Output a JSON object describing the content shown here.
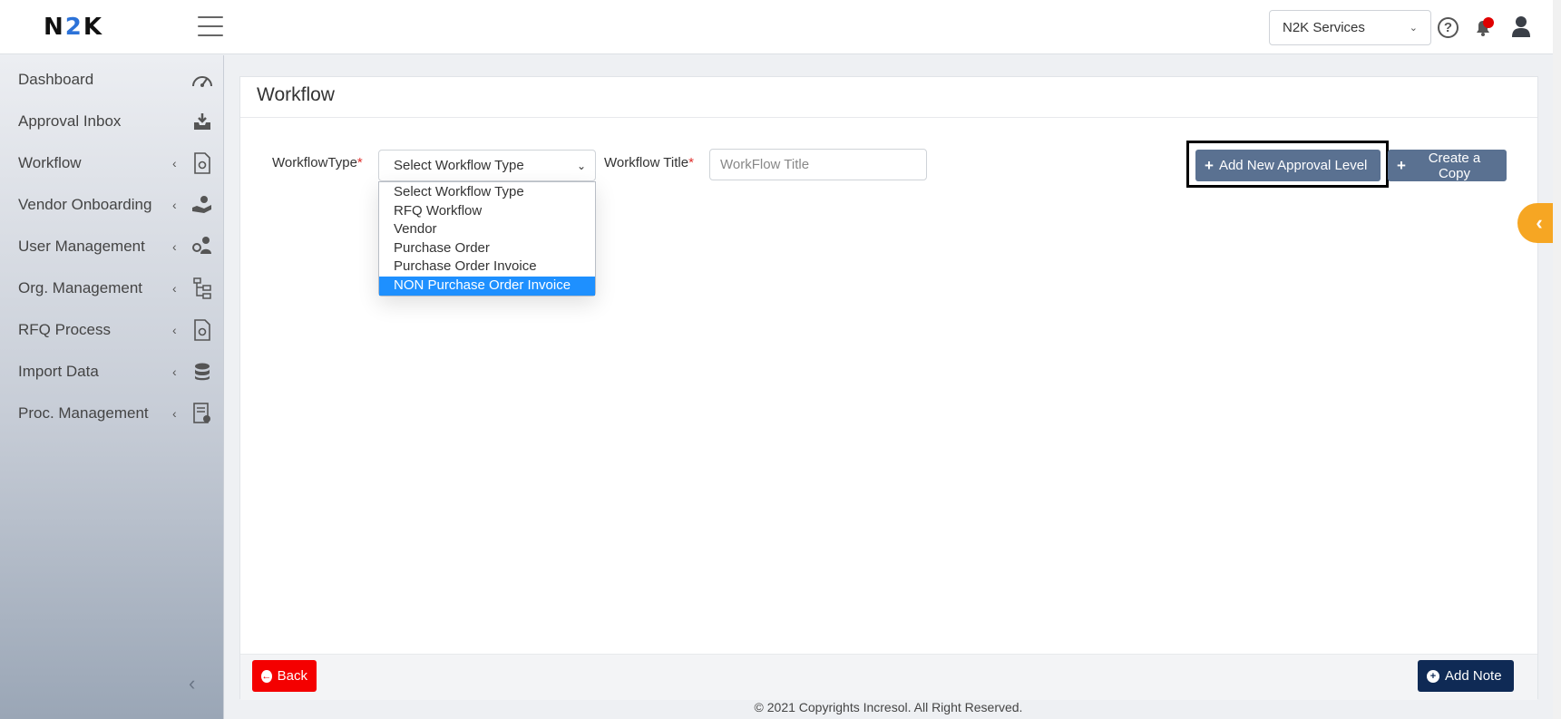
{
  "header": {
    "logo_text": "N2K",
    "company_selector": {
      "value": "N2K Services",
      "options": [
        "N2K Services"
      ]
    },
    "icons": [
      "menu-icon",
      "help-icon",
      "bell-icon",
      "user-icon"
    ],
    "notification_badge_color": "#e00000"
  },
  "sidebar": {
    "items": [
      {
        "label": "Dashboard",
        "icon": "dashboard-icon",
        "expandable": false
      },
      {
        "label": "Approval Inbox",
        "icon": "inbox-icon",
        "expandable": false
      },
      {
        "label": "Workflow",
        "icon": "document-gear-icon",
        "expandable": true
      },
      {
        "label": "Vendor Onboarding",
        "icon": "hand-person-icon",
        "expandable": true
      },
      {
        "label": "User Management",
        "icon": "users-gear-icon",
        "expandable": true
      },
      {
        "label": "Org. Management",
        "icon": "org-tree-icon",
        "expandable": true
      },
      {
        "label": "RFQ Process",
        "icon": "document-gear-icon",
        "expandable": true
      },
      {
        "label": "Import Data",
        "icon": "database-import-icon",
        "expandable": true
      },
      {
        "label": "Proc. Management",
        "icon": "report-gear-icon",
        "expandable": true
      }
    ]
  },
  "main": {
    "title": "Workflow",
    "workflow_type": {
      "label": "WorkflowType",
      "required_mark": "*",
      "value": "Select Workflow Type",
      "options": [
        "Select Workflow Type",
        "RFQ Workflow",
        "Vendor",
        "Purchase Order",
        "Purchase Order Invoice",
        "NON Purchase Order Invoice"
      ],
      "highlighted_option": "NON Purchase Order Invoice"
    },
    "workflow_title": {
      "label": "Workflow Title",
      "required_mark": "*",
      "value": "",
      "placeholder": "WorkFlow Title"
    },
    "buttons": {
      "add_approval_level": "Add New Approval Level",
      "create_copy": "Create a Copy",
      "back": "Back",
      "add_note": "Add Note"
    }
  },
  "footer": {
    "copyright": "© 2021 Copyrights Incresol. All Right Reserved."
  },
  "colors": {
    "primary_button": "#5a7191",
    "back_button": "#f40000",
    "note_button": "#0f2a55",
    "selected_option": "#1e90ff",
    "side_tab": "#f6a623"
  }
}
